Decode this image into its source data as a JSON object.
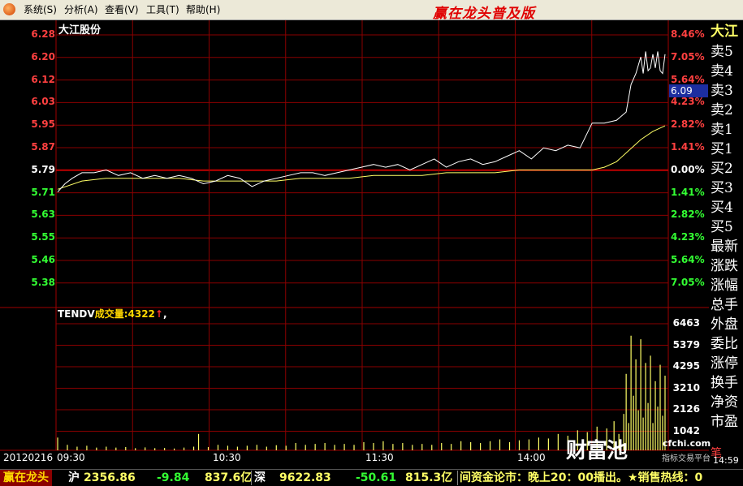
{
  "menu": {
    "items": [
      "系统(S)",
      "分析(A)",
      "查看(V)",
      "工具(T)",
      "帮助(H)"
    ],
    "app_title": "赢在龙头普及版"
  },
  "stock": {
    "name": "大江股份",
    "current_price": "6.09"
  },
  "price_axis": {
    "labels": [
      "6.28",
      "6.20",
      "6.12",
      "6.03",
      "5.95",
      "5.87",
      "5.79",
      "5.71",
      "5.63",
      "5.55",
      "5.46",
      "5.38"
    ],
    "colors": [
      "#ff4040",
      "#ff4040",
      "#ff4040",
      "#ff4040",
      "#ff4040",
      "#ff4040",
      "#ffffff",
      "#33ff33",
      "#33ff33",
      "#33ff33",
      "#33ff33",
      "#33ff33"
    ]
  },
  "pct_axis": {
    "labels": [
      "8.46%",
      "7.05%",
      "5.64%",
      "4.23%",
      "2.82%",
      "1.41%",
      "0.00%",
      "1.41%",
      "2.82%",
      "4.23%",
      "5.64%",
      "7.05%"
    ],
    "colors": [
      "#ff4040",
      "#ff4040",
      "#ff4040",
      "#ff4040",
      "#ff4040",
      "#ff4040",
      "#ffffff",
      "#33ff33",
      "#33ff33",
      "#33ff33",
      "#33ff33",
      "#33ff33"
    ]
  },
  "volume": {
    "indicator": "TENDV",
    "label": "成交量:",
    "value": "4322",
    "arrow": "↑",
    "suffix": ",",
    "axis_labels": [
      "6463",
      "5379",
      "4295",
      "3210",
      "2126",
      "1042"
    ]
  },
  "time_axis": {
    "date": "20120216",
    "labels": [
      "09:30",
      "10:30",
      "11:30",
      "14:00"
    ]
  },
  "right_panel": {
    "name": "大江",
    "labels": [
      "卖5",
      "卖4",
      "卖3",
      "卖2",
      "卖1",
      "买1",
      "买2",
      "买3",
      "买4",
      "买5",
      "最新",
      "涨跌",
      "涨幅",
      "总手",
      "外盘",
      "委比",
      "涨停",
      "换手",
      "净资",
      "市盈"
    ],
    "extra": "笔",
    "time": "14:59"
  },
  "watermark": {
    "text": "财富池",
    "url": "cfchi.com",
    "sub": "指标交易平台"
  },
  "statusbar": {
    "brand": "赢在龙头",
    "sh_label": "沪",
    "sh_index": "2356.86",
    "sh_change": "-9.84",
    "sh_amount": "837.6亿",
    "sz_label": "深",
    "sz_index": "9622.83",
    "sz_change": "-50.61",
    "sz_amount": "815.3亿",
    "ticker": "间资金论市：晚上20：00播出。★销售热线：0"
  },
  "chart_data": {
    "type": "line",
    "title": "大江股份",
    "x_range": [
      "09:30",
      "15:00"
    ],
    "ylim": [
      5.32,
      6.34
    ],
    "prev_close": 5.79,
    "series": [
      {
        "name": "price",
        "color": "#ffffff",
        "x": [
          0,
          3,
          6,
          10,
          15,
          20,
          25,
          30,
          35,
          40,
          45,
          50,
          55,
          60,
          65,
          70,
          75,
          80,
          85,
          90,
          95,
          100,
          105,
          110,
          115,
          120,
          125,
          130,
          135,
          140,
          145,
          150,
          155,
          160,
          165,
          170,
          175,
          180,
          185,
          190,
          195,
          200,
          205,
          210,
          215,
          220,
          225,
          230,
          234,
          236,
          238,
          240,
          241,
          242,
          243,
          244,
          245,
          246,
          247,
          248,
          249,
          250
        ],
        "y": [
          5.71,
          5.74,
          5.76,
          5.78,
          5.78,
          5.79,
          5.77,
          5.78,
          5.76,
          5.77,
          5.76,
          5.77,
          5.76,
          5.74,
          5.75,
          5.77,
          5.76,
          5.73,
          5.75,
          5.76,
          5.77,
          5.78,
          5.78,
          5.77,
          5.78,
          5.79,
          5.8,
          5.81,
          5.8,
          5.81,
          5.79,
          5.81,
          5.83,
          5.8,
          5.82,
          5.83,
          5.81,
          5.82,
          5.84,
          5.86,
          5.83,
          5.87,
          5.86,
          5.88,
          5.87,
          5.96,
          5.96,
          5.97,
          6.0,
          6.1,
          6.14,
          6.2,
          6.14,
          6.22,
          6.15,
          6.16,
          6.21,
          6.16,
          6.22,
          6.15,
          6.14,
          6.21
        ]
      },
      {
        "name": "avg",
        "color": "#ffff66",
        "x": [
          0,
          10,
          20,
          30,
          40,
          50,
          60,
          70,
          80,
          90,
          100,
          110,
          120,
          130,
          140,
          150,
          160,
          170,
          180,
          190,
          200,
          210,
          220,
          225,
          230,
          235,
          240,
          245,
          250
        ],
        "y": [
          5.72,
          5.75,
          5.76,
          5.76,
          5.76,
          5.76,
          5.75,
          5.75,
          5.75,
          5.75,
          5.76,
          5.76,
          5.76,
          5.77,
          5.77,
          5.77,
          5.78,
          5.78,
          5.78,
          5.79,
          5.79,
          5.79,
          5.79,
          5.8,
          5.82,
          5.86,
          5.9,
          5.93,
          5.95
        ]
      }
    ],
    "volume_ylim": [
      0,
      7000
    ],
    "volume": [
      {
        "x": 0,
        "v": 700
      },
      {
        "x": 4,
        "v": 300
      },
      {
        "x": 8,
        "v": 200
      },
      {
        "x": 12,
        "v": 250
      },
      {
        "x": 16,
        "v": 150
      },
      {
        "x": 20,
        "v": 200
      },
      {
        "x": 24,
        "v": 150
      },
      {
        "x": 28,
        "v": 180
      },
      {
        "x": 32,
        "v": 120
      },
      {
        "x": 36,
        "v": 160
      },
      {
        "x": 40,
        "v": 120
      },
      {
        "x": 44,
        "v": 130
      },
      {
        "x": 48,
        "v": 100
      },
      {
        "x": 52,
        "v": 150
      },
      {
        "x": 56,
        "v": 200
      },
      {
        "x": 58,
        "v": 900
      },
      {
        "x": 62,
        "v": 180
      },
      {
        "x": 66,
        "v": 300
      },
      {
        "x": 70,
        "v": 250
      },
      {
        "x": 74,
        "v": 200
      },
      {
        "x": 78,
        "v": 250
      },
      {
        "x": 82,
        "v": 300
      },
      {
        "x": 86,
        "v": 200
      },
      {
        "x": 90,
        "v": 280
      },
      {
        "x": 94,
        "v": 250
      },
      {
        "x": 98,
        "v": 400
      },
      {
        "x": 102,
        "v": 300
      },
      {
        "x": 106,
        "v": 350
      },
      {
        "x": 110,
        "v": 400
      },
      {
        "x": 114,
        "v": 300
      },
      {
        "x": 118,
        "v": 350
      },
      {
        "x": 122,
        "v": 300
      },
      {
        "x": 126,
        "v": 450
      },
      {
        "x": 130,
        "v": 400
      },
      {
        "x": 134,
        "v": 500
      },
      {
        "x": 138,
        "v": 350
      },
      {
        "x": 142,
        "v": 400
      },
      {
        "x": 146,
        "v": 300
      },
      {
        "x": 150,
        "v": 350
      },
      {
        "x": 154,
        "v": 300
      },
      {
        "x": 158,
        "v": 400
      },
      {
        "x": 162,
        "v": 350
      },
      {
        "x": 166,
        "v": 500
      },
      {
        "x": 170,
        "v": 450
      },
      {
        "x": 174,
        "v": 400
      },
      {
        "x": 178,
        "v": 500
      },
      {
        "x": 182,
        "v": 600
      },
      {
        "x": 186,
        "v": 450
      },
      {
        "x": 190,
        "v": 550
      },
      {
        "x": 194,
        "v": 600
      },
      {
        "x": 198,
        "v": 700
      },
      {
        "x": 202,
        "v": 650
      },
      {
        "x": 206,
        "v": 900
      },
      {
        "x": 210,
        "v": 800
      },
      {
        "x": 214,
        "v": 1100
      },
      {
        "x": 218,
        "v": 1000
      },
      {
        "x": 222,
        "v": 1300
      },
      {
        "x": 226,
        "v": 1200
      },
      {
        "x": 229,
        "v": 1600
      },
      {
        "x": 231,
        "v": 900
      },
      {
        "x": 233,
        "v": 2000
      },
      {
        "x": 234,
        "v": 4200
      },
      {
        "x": 235,
        "v": 1500
      },
      {
        "x": 236,
        "v": 6300
      },
      {
        "x": 237,
        "v": 3000
      },
      {
        "x": 238,
        "v": 5000
      },
      {
        "x": 239,
        "v": 2200
      },
      {
        "x": 240,
        "v": 6100
      },
      {
        "x": 241,
        "v": 1800
      },
      {
        "x": 242,
        "v": 4800
      },
      {
        "x": 243,
        "v": 2600
      },
      {
        "x": 244,
        "v": 5200
      },
      {
        "x": 245,
        "v": 1500
      },
      {
        "x": 246,
        "v": 3800
      },
      {
        "x": 247,
        "v": 2400
      },
      {
        "x": 248,
        "v": 4700
      },
      {
        "x": 249,
        "v": 1900
      },
      {
        "x": 250,
        "v": 4100
      }
    ]
  }
}
